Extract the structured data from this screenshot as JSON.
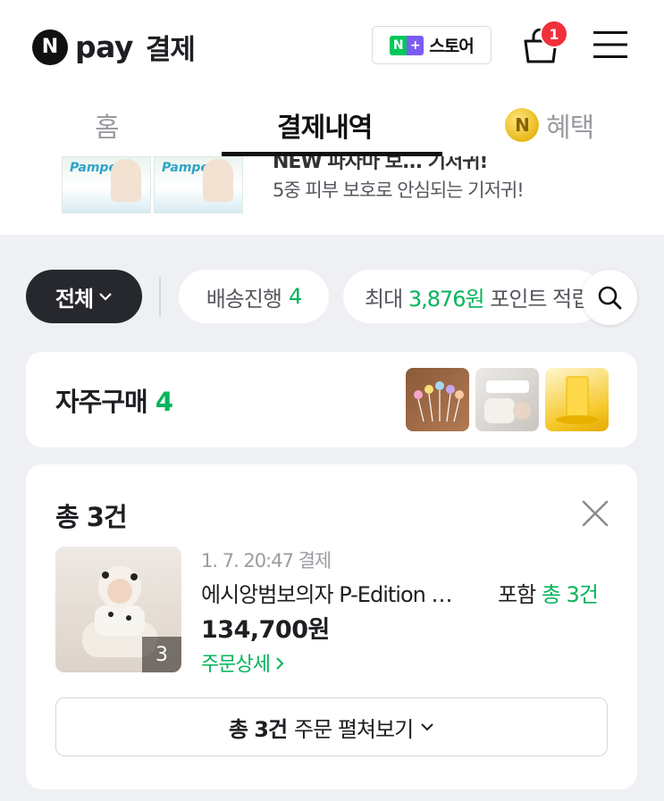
{
  "header": {
    "logo_n": "N",
    "logo_pay": "pay",
    "logo_title": "결제",
    "store": {
      "icon_n": "N",
      "icon_plus": "+",
      "label": "스토어"
    },
    "cart_badge": "1"
  },
  "tabs": [
    {
      "label": "홈",
      "active": false
    },
    {
      "label": "결제내역",
      "active": true
    },
    {
      "label": "혜택",
      "active": false,
      "coin": "N"
    }
  ],
  "ad": {
    "brand1": "Pampers",
    "brand2": "Pampers",
    "headline_cut": "NEW 파자마 보... 기저귀!",
    "text": "5중 피부 보호로 안심되는 기저귀!"
  },
  "filters": {
    "all_label": "전체",
    "shipping_label": "배송진행",
    "shipping_count": "4",
    "point_prefix": "최대",
    "point_amount": "3,876원",
    "point_suffix": "포인트 적립"
  },
  "frequent": {
    "label": "자주구매",
    "count": "4"
  },
  "orders": {
    "title": "총 3건",
    "item": {
      "date": "1. 7. 20:47 결제",
      "name": "에시앙범보의자 P-Edition …",
      "incl_prefix": "포함",
      "incl_count": "총 3건",
      "price": "134,700원",
      "detail_link": "주문상세",
      "image_count": "3"
    },
    "expand": {
      "bold": "총 3건",
      "label": "주문 펼쳐보기"
    }
  },
  "colors": {
    "accent": "#03b45a",
    "badge": "#f0303b",
    "dark_chip": "#26282d"
  }
}
